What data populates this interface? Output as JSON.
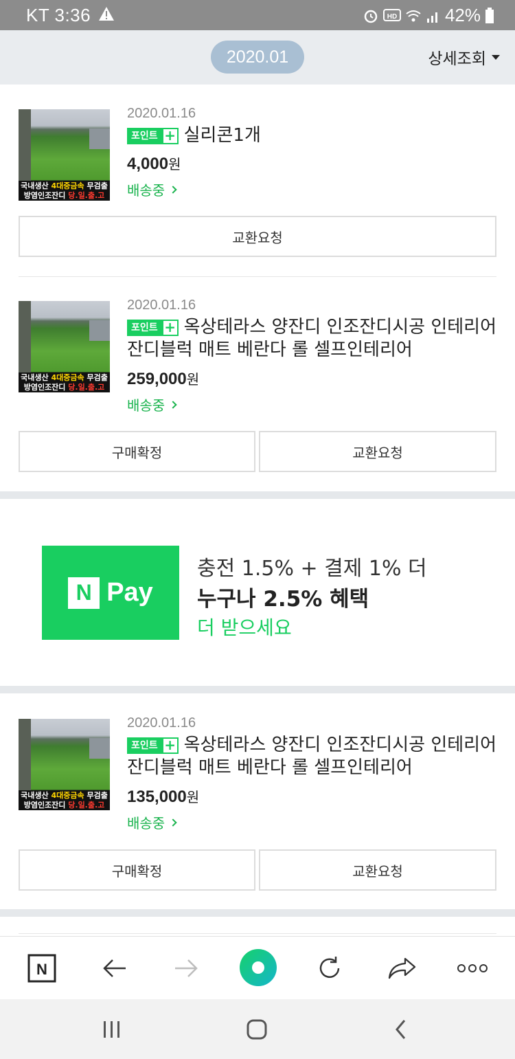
{
  "status_bar": {
    "carrier_time": "KT 3:36",
    "battery": "42%",
    "icons": [
      "warning-icon",
      "alarm-icon",
      "hd-icon",
      "wifi-icon",
      "signal-icon",
      "battery-icon"
    ]
  },
  "header": {
    "month": "2020.01",
    "detail_label": "상세조회"
  },
  "thumbnail_caption": {
    "line1_a": "국내생산 ",
    "line1_b": "4대중금속",
    "line1_c": " 무검출",
    "line2_a": "방염인조잔디 ",
    "line2_b": "당.일.출.고"
  },
  "badge": {
    "text": "포인트",
    "plus": "+"
  },
  "orders": [
    {
      "date": "2020.01.16",
      "title": "실리콘1개",
      "price": "4,000",
      "won": "원",
      "status": "배송중",
      "buttons": [
        "교환요청"
      ]
    },
    {
      "date": "2020.01.16",
      "title": "옥상테라스 양잔디 인조잔디시공 인테리어 잔디블럭 매트 베란다 롤 셀프인테리어",
      "price": "259,000",
      "won": "원",
      "status": "배송중",
      "buttons": [
        "구매확정",
        "교환요청"
      ]
    },
    {
      "date": "2020.01.16",
      "title": "옥상테라스 양잔디 인조잔디시공 인테리어 잔디블럭 매트 베란다 롤 셀프인테리어",
      "price": "135,000",
      "won": "원",
      "status": "배송중",
      "buttons": [
        "구매확정",
        "교환요청"
      ]
    }
  ],
  "ad": {
    "logo_n": "N",
    "logo_pay": "Pay",
    "line1": "충전 1.5% + 결제 1% 더",
    "line2": "누구나  2.5% 혜택",
    "line3": "더 받으세요"
  },
  "toolbar": {
    "home_n": "N",
    "icons": [
      "naver-home-icon",
      "back-arrow-icon",
      "forward-arrow-icon",
      "green-dot-icon",
      "refresh-icon",
      "share-icon",
      "more-icon"
    ]
  },
  "colors": {
    "accent_green": "#19ce60",
    "status_green": "#19b34d",
    "month_pill": "#a9bfd3",
    "header_bg": "#e9ecef"
  }
}
